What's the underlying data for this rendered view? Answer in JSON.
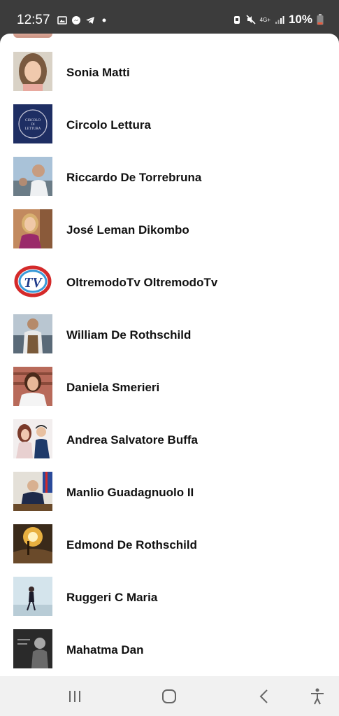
{
  "status_bar": {
    "time": "12:57",
    "network": "4G+",
    "battery": "10%"
  },
  "contacts": [
    {
      "name": "Sonia Matti",
      "avatar": "woman-portrait"
    },
    {
      "name": "Circolo Lettura",
      "avatar": "circle-logo",
      "logo_text": [
        "CIRCOLO",
        "DI",
        "LETTURA"
      ]
    },
    {
      "name": "Riccardo De Torrebruna",
      "avatar": "man-outdoors"
    },
    {
      "name": "José Leman Dikombo",
      "avatar": "woman-blonde"
    },
    {
      "name": "OltremodoTv OltremodoTv",
      "avatar": "tv-logo",
      "logo_text": "TV"
    },
    {
      "name": "William De Rothschild",
      "avatar": "man-vest"
    },
    {
      "name": "Daniela Smerieri",
      "avatar": "woman-bookshelf"
    },
    {
      "name": "Andrea Salvatore Buffa",
      "avatar": "couple"
    },
    {
      "name": "Manlio Guadagnuolo II",
      "avatar": "man-desk"
    },
    {
      "name": "Edmond De Rothschild",
      "avatar": "painting"
    },
    {
      "name": "Ruggeri C Maria",
      "avatar": "woman-walking"
    },
    {
      "name": "Mahatma Dan",
      "avatar": "man-gray"
    }
  ],
  "nav": {
    "recents": "recents-icon",
    "home": "home-icon",
    "back": "back-icon",
    "accessibility": "accessibility-icon"
  }
}
